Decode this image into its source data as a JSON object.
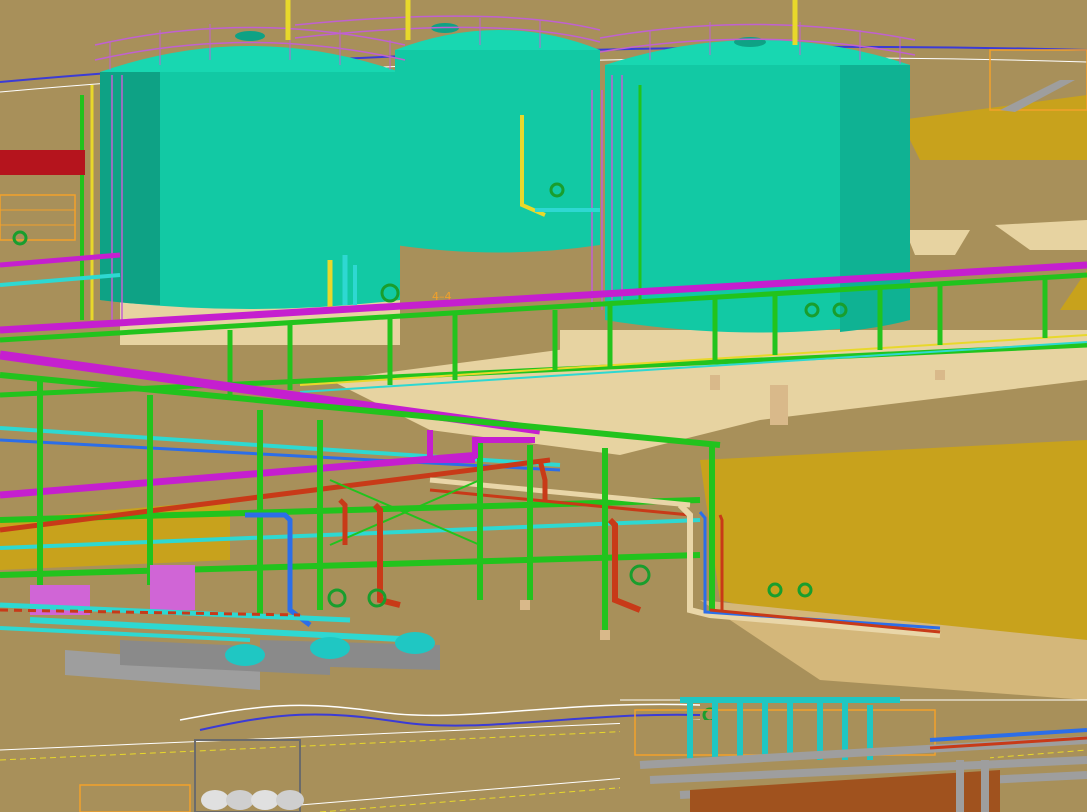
{
  "scene": {
    "description_visible_text": [
      "4–4"
    ],
    "colors": {
      "ground": "#a8905a",
      "ground_light": "#c9ab6a",
      "pad_light": "#e7d3a1",
      "tank": "#12c9a4",
      "tank_shadow": "#0ea285",
      "rail": "#c061d1",
      "steel_green": "#22c31d",
      "pipe_magenta": "#c51fcf",
      "pipe_cyan": "#2ed8d2",
      "pipe_red": "#c83a18",
      "pipe_yellow": "#e8d82b",
      "pipe_blue": "#2c6ee8",
      "pipe_beige": "#e9d6a8",
      "yellow_ramp": "#c8a21c",
      "handrail_orange": "#f2a12a",
      "valve_green": "#199e2d",
      "equipment_gray": "#9e9e9e",
      "equipment_dark": "#6b6b6b",
      "pump_teal": "#1fc7c3"
    },
    "label_tag": "4–4"
  }
}
